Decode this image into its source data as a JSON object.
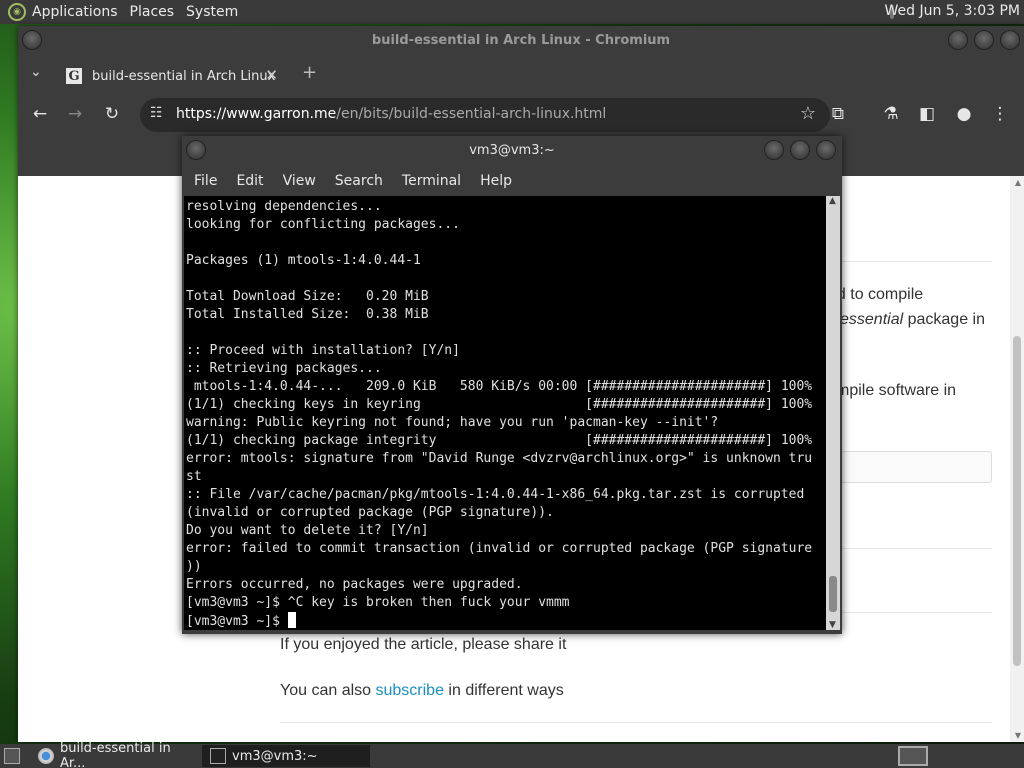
{
  "top_panel": {
    "menus": [
      "Applications",
      "Places",
      "System"
    ],
    "clock": "Wed Jun  5,  3:03 PM"
  },
  "browser": {
    "window_title": "build-essential in Arch Linux - Chromium",
    "tab": {
      "title": "build-essential in Arch Linux",
      "favicon": "G"
    },
    "url_domain": "https://www.garron.me",
    "url_path": "/en/bits/build-essential-arch-linux.html",
    "page": {
      "para1_line1": "ed to compile",
      "para1_line2_italic": "essential",
      "para1_line2_rest": " package in",
      "para2": "mpile software in",
      "share_text": "If you enjoyed the article, please share it",
      "also_prefix": "You can also ",
      "subscribe_link": "subscribe",
      "also_suffix": " in different ways"
    }
  },
  "terminal": {
    "title": "vm3@vm3:~",
    "menus": [
      "File",
      "Edit",
      "View",
      "Search",
      "Terminal",
      "Help"
    ],
    "lines": [
      "resolving dependencies...",
      "looking for conflicting packages...",
      "",
      "Packages (1) mtools-1:4.0.44-1",
      "",
      "Total Download Size:   0.20 MiB",
      "Total Installed Size:  0.38 MiB",
      "",
      ":: Proceed with installation? [Y/n]",
      ":: Retrieving packages...",
      " mtools-1:4.0.44-...   209.0 KiB   580 KiB/s 00:00 [######################] 100%",
      "(1/1) checking keys in keyring                     [######################] 100%",
      "warning: Public keyring not found; have you run 'pacman-key --init'?",
      "(1/1) checking package integrity                   [######################] 100%",
      "error: mtools: signature from \"David Runge <dvzrv@archlinux.org>\" is unknown tru",
      "st",
      ":: File /var/cache/pacman/pkg/mtools-1:4.0.44-1-x86_64.pkg.tar.zst is corrupted",
      "(invalid or corrupted package (PGP signature)).",
      "Do you want to delete it? [Y/n]",
      "error: failed to commit transaction (invalid or corrupted package (PGP signature",
      "))",
      "Errors occurred, no packages were upgraded.",
      "[vm3@vm3 ~]$ ^C key is broken then fuck your vmmm"
    ],
    "prompt": "[vm3@vm3 ~]$ "
  },
  "taskbar": {
    "items": [
      {
        "label": "build-essential in Ar...",
        "icon": "chromium-icon"
      },
      {
        "label": "vm3@vm3:~",
        "icon": "terminal-icon"
      }
    ]
  },
  "colors": {
    "link": "#1a8fbf",
    "terminal_bg": "#000000",
    "panel": "#3a3a3a"
  }
}
